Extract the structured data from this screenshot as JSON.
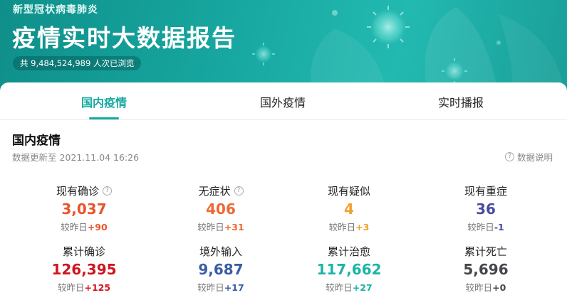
{
  "banner": {
    "subtitle": "新型冠状病毒肺炎",
    "title": "疫情实时大数据报告",
    "views": "共 9,484,524,989 人次已浏览"
  },
  "tabs": [
    "国内疫情",
    "国外疫情",
    "实时播报"
  ],
  "section": {
    "title": "国内疫情",
    "update_time": "数据更新至 2021.11.04 16:26",
    "help_label": "数据说明"
  },
  "delta_prefix": "较昨日",
  "stats": [
    {
      "label": "现有确诊",
      "value": "3,037",
      "delta": "+90",
      "color": "#e8542b",
      "delta_color": "#e8542b",
      "help": true
    },
    {
      "label": "无症状",
      "value": "406",
      "delta": "+31",
      "color": "#ec6a35",
      "delta_color": "#ec6a35",
      "help": true
    },
    {
      "label": "现有疑似",
      "value": "4",
      "delta": "+3",
      "color": "#f0a02e",
      "delta_color": "#f0a02e",
      "help": false
    },
    {
      "label": "现有重症",
      "value": "36",
      "delta": "-1",
      "color": "#4a4c9c",
      "delta_color": "#4a4c9c",
      "help": false
    },
    {
      "label": "累计确诊",
      "value": "126,395",
      "delta": "+125",
      "color": "#d0151e",
      "delta_color": "#d0151e",
      "help": false
    },
    {
      "label": "境外输入",
      "value": "9,687",
      "delta": "+17",
      "color": "#3a5da6",
      "delta_color": "#3a5da6",
      "help": false
    },
    {
      "label": "累计治愈",
      "value": "117,662",
      "delta": "+27",
      "color": "#1eb3a6",
      "delta_color": "#1eb3a6",
      "help": false
    },
    {
      "label": "累计死亡",
      "value": "5,696",
      "delta": "+0",
      "color": "#44474c",
      "delta_color": "#44474c",
      "help": false
    }
  ]
}
